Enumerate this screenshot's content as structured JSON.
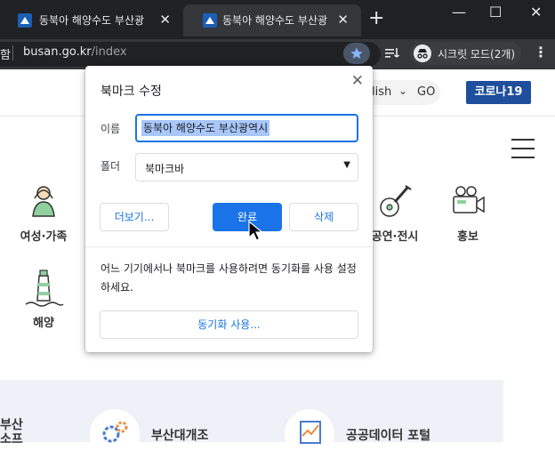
{
  "browser": {
    "tabs": [
      {
        "title": "동북아 해양수도 부산광역시",
        "active": false
      },
      {
        "title": "동북아 해양수도 부산광역시",
        "active": true
      }
    ],
    "url_host": "busan.go.kr",
    "url_path": "/index",
    "omnibox_left_fragment": "함",
    "incognito_label": "시크릿 모드(2개)"
  },
  "page": {
    "lang_label": "lish",
    "go_label": "GO",
    "corona_button": "코로나19",
    "categories": [
      {
        "label": "여성·가족",
        "icon": "woman-icon"
      },
      {
        "label": "공연·전시",
        "icon": "guitar-icon"
      },
      {
        "label": "홍보",
        "icon": "camera-icon"
      },
      {
        "label": "해양",
        "icon": "lighthouse-icon"
      }
    ],
    "services": [
      {
        "label": "부산대개조",
        "icon": "gears-icon"
      },
      {
        "label": "공공데이터 포털",
        "icon": "data-chart-icon"
      }
    ],
    "left_cut_text": [
      "부산",
      "소프"
    ]
  },
  "dialog": {
    "title": "북마크 수정",
    "name_label": "이름",
    "name_value": "동북아 해양수도 부산광역시",
    "folder_label": "폴더",
    "folder_value": "북마크바",
    "more_button": "더보기...",
    "done_button": "완료",
    "delete_button": "삭제",
    "sync_text": "어느 기기에서나 북마크를 사용하려면 동기화를 사용 설정하세요.",
    "sync_button": "동기화 사용..."
  },
  "colors": {
    "accent": "#1a73e8",
    "corona": "#1e4e9c",
    "chrome_dark": "#202124"
  }
}
